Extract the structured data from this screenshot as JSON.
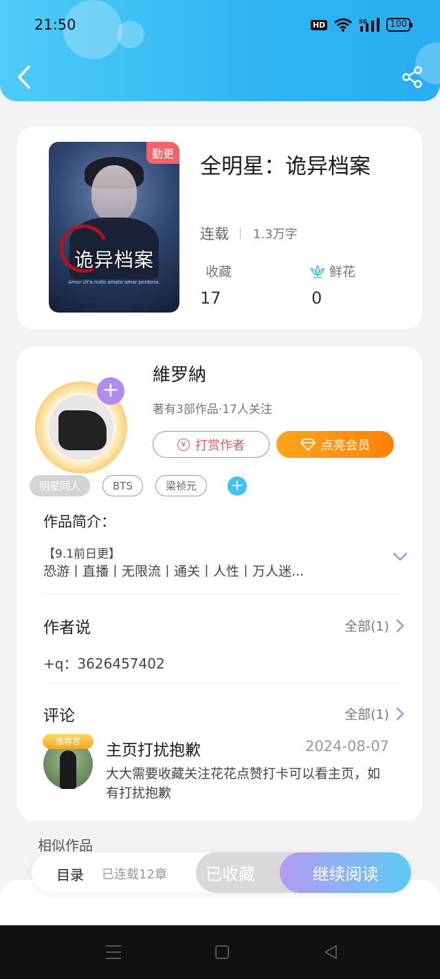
{
  "status_bar": {
    "time": "21:50",
    "hd": "HD",
    "network": "5G",
    "battery": "100"
  },
  "book": {
    "cover_title": "诡异档案",
    "cover_subtitle": "Amor ch'a nullo amato amar perdona.",
    "tag": "勤更",
    "title": "全明星：诡异档案",
    "status": "连载",
    "word_count": "1.3万字",
    "favorites_label": "收藏",
    "favorites_value": "17",
    "flowers_label": "鲜花",
    "flowers_value": "0"
  },
  "author": {
    "name": "維罗納",
    "meta": "著有3部作品·17人关注",
    "reward_label": "打赏作者",
    "vip_label": "点亮会员"
  },
  "tags": [
    "明星同人",
    "BTS",
    "梁祯元"
  ],
  "intro": {
    "heading": "作品简介：",
    "line1": "【9.1前日更】",
    "line2": "恐游丨直播丨无限流丨通关丨人性丨万人迷..."
  },
  "author_says": {
    "heading": "作者说",
    "all_label": "全部(1)",
    "text": "+q：3626457402"
  },
  "comments": {
    "heading": "评论",
    "all_label": "全部(1)",
    "badge": "推荐官",
    "name": "主页打扰抱歉",
    "date": "2024-08-07",
    "text": "大大需要收藏关注花花点赞打卡可以看主页，如有打扰抱歉"
  },
  "similar_heading": "相似作品",
  "bottom": {
    "toc_label": "目录",
    "chapters": "已连载12章",
    "collected_label": "已收藏",
    "read_label": "继续阅读"
  },
  "colors": {
    "header": "#2fb4f2",
    "accent_purple": "#b08bf0",
    "vip_orange": "#ff8109",
    "reward_red": "#e4585d"
  }
}
